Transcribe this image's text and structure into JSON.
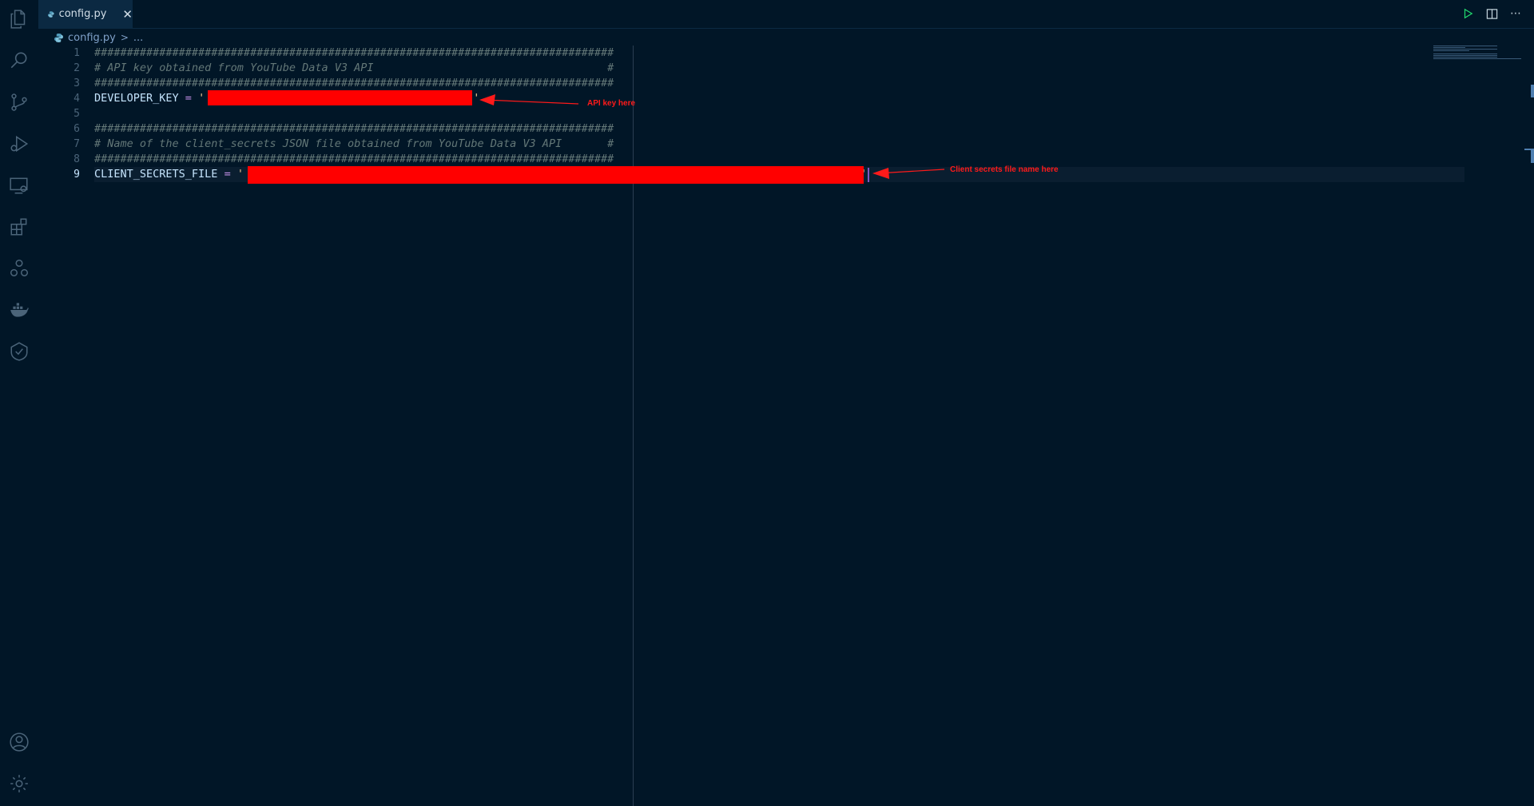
{
  "tabs": [
    {
      "label": "config.py",
      "active": true
    }
  ],
  "breadcrumb": {
    "file": "config.py",
    "separator": ">",
    "tail": "..."
  },
  "editor": {
    "lines": [
      {
        "number": "1",
        "text": "################################################################################"
      },
      {
        "number": "2",
        "text": "# API key obtained from YouTube Data V3 API                                    #"
      },
      {
        "number": "3",
        "text": "################################################################################"
      },
      {
        "number": "4",
        "var": "DEVELOPER_KEY",
        "op": " = ",
        "quote_open": "'",
        "quote_close": "'"
      },
      {
        "number": "5",
        "text": ""
      },
      {
        "number": "6",
        "text": "################################################################################"
      },
      {
        "number": "7",
        "text": "# Name of the client_secrets JSON file obtained from YouTube Data V3 API       #"
      },
      {
        "number": "8",
        "text": "################################################################################"
      },
      {
        "number": "9",
        "var": "CLIENT_SECRETS_FILE",
        "op": " = ",
        "quote_open": "'",
        "quote_close": "'"
      }
    ],
    "active_line": "9"
  },
  "annotations": {
    "api_key": "API key here",
    "client_secrets": "Client secrets file name here"
  },
  "colors": {
    "background": "#011627",
    "redaction": "#ff0000",
    "annotation": "#ff1a1a"
  },
  "icons": {
    "activity_bar": [
      "files-icon",
      "search-icon",
      "source-control-icon",
      "run-debug-icon",
      "remote-explorer-icon",
      "extensions-icon",
      "cluster-icon",
      "docker-icon",
      "testing-icon",
      "account-icon",
      "settings-gear-icon"
    ],
    "tab_actions": [
      "run-icon",
      "split-editor-icon",
      "more-actions-icon"
    ]
  }
}
